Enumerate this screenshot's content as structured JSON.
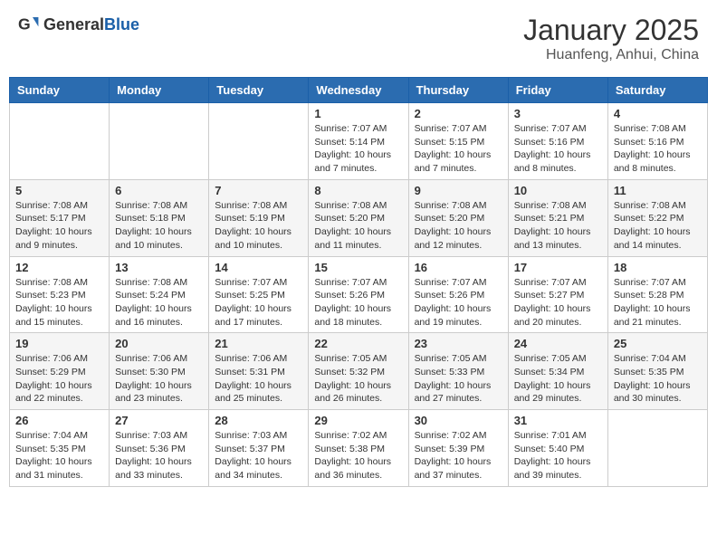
{
  "header": {
    "logo_general": "General",
    "logo_blue": "Blue",
    "month": "January 2025",
    "location": "Huanfeng, Anhui, China"
  },
  "weekdays": [
    "Sunday",
    "Monday",
    "Tuesday",
    "Wednesday",
    "Thursday",
    "Friday",
    "Saturday"
  ],
  "weeks": [
    [
      {
        "day": "",
        "info": ""
      },
      {
        "day": "",
        "info": ""
      },
      {
        "day": "",
        "info": ""
      },
      {
        "day": "1",
        "info": "Sunrise: 7:07 AM\nSunset: 5:14 PM\nDaylight: 10 hours\nand 7 minutes."
      },
      {
        "day": "2",
        "info": "Sunrise: 7:07 AM\nSunset: 5:15 PM\nDaylight: 10 hours\nand 7 minutes."
      },
      {
        "day": "3",
        "info": "Sunrise: 7:07 AM\nSunset: 5:16 PM\nDaylight: 10 hours\nand 8 minutes."
      },
      {
        "day": "4",
        "info": "Sunrise: 7:08 AM\nSunset: 5:16 PM\nDaylight: 10 hours\nand 8 minutes."
      }
    ],
    [
      {
        "day": "5",
        "info": "Sunrise: 7:08 AM\nSunset: 5:17 PM\nDaylight: 10 hours\nand 9 minutes."
      },
      {
        "day": "6",
        "info": "Sunrise: 7:08 AM\nSunset: 5:18 PM\nDaylight: 10 hours\nand 10 minutes."
      },
      {
        "day": "7",
        "info": "Sunrise: 7:08 AM\nSunset: 5:19 PM\nDaylight: 10 hours\nand 10 minutes."
      },
      {
        "day": "8",
        "info": "Sunrise: 7:08 AM\nSunset: 5:20 PM\nDaylight: 10 hours\nand 11 minutes."
      },
      {
        "day": "9",
        "info": "Sunrise: 7:08 AM\nSunset: 5:20 PM\nDaylight: 10 hours\nand 12 minutes."
      },
      {
        "day": "10",
        "info": "Sunrise: 7:08 AM\nSunset: 5:21 PM\nDaylight: 10 hours\nand 13 minutes."
      },
      {
        "day": "11",
        "info": "Sunrise: 7:08 AM\nSunset: 5:22 PM\nDaylight: 10 hours\nand 14 minutes."
      }
    ],
    [
      {
        "day": "12",
        "info": "Sunrise: 7:08 AM\nSunset: 5:23 PM\nDaylight: 10 hours\nand 15 minutes."
      },
      {
        "day": "13",
        "info": "Sunrise: 7:08 AM\nSunset: 5:24 PM\nDaylight: 10 hours\nand 16 minutes."
      },
      {
        "day": "14",
        "info": "Sunrise: 7:07 AM\nSunset: 5:25 PM\nDaylight: 10 hours\nand 17 minutes."
      },
      {
        "day": "15",
        "info": "Sunrise: 7:07 AM\nSunset: 5:26 PM\nDaylight: 10 hours\nand 18 minutes."
      },
      {
        "day": "16",
        "info": "Sunrise: 7:07 AM\nSunset: 5:26 PM\nDaylight: 10 hours\nand 19 minutes."
      },
      {
        "day": "17",
        "info": "Sunrise: 7:07 AM\nSunset: 5:27 PM\nDaylight: 10 hours\nand 20 minutes."
      },
      {
        "day": "18",
        "info": "Sunrise: 7:07 AM\nSunset: 5:28 PM\nDaylight: 10 hours\nand 21 minutes."
      }
    ],
    [
      {
        "day": "19",
        "info": "Sunrise: 7:06 AM\nSunset: 5:29 PM\nDaylight: 10 hours\nand 22 minutes."
      },
      {
        "day": "20",
        "info": "Sunrise: 7:06 AM\nSunset: 5:30 PM\nDaylight: 10 hours\nand 23 minutes."
      },
      {
        "day": "21",
        "info": "Sunrise: 7:06 AM\nSunset: 5:31 PM\nDaylight: 10 hours\nand 25 minutes."
      },
      {
        "day": "22",
        "info": "Sunrise: 7:05 AM\nSunset: 5:32 PM\nDaylight: 10 hours\nand 26 minutes."
      },
      {
        "day": "23",
        "info": "Sunrise: 7:05 AM\nSunset: 5:33 PM\nDaylight: 10 hours\nand 27 minutes."
      },
      {
        "day": "24",
        "info": "Sunrise: 7:05 AM\nSunset: 5:34 PM\nDaylight: 10 hours\nand 29 minutes."
      },
      {
        "day": "25",
        "info": "Sunrise: 7:04 AM\nSunset: 5:35 PM\nDaylight: 10 hours\nand 30 minutes."
      }
    ],
    [
      {
        "day": "26",
        "info": "Sunrise: 7:04 AM\nSunset: 5:35 PM\nDaylight: 10 hours\nand 31 minutes."
      },
      {
        "day": "27",
        "info": "Sunrise: 7:03 AM\nSunset: 5:36 PM\nDaylight: 10 hours\nand 33 minutes."
      },
      {
        "day": "28",
        "info": "Sunrise: 7:03 AM\nSunset: 5:37 PM\nDaylight: 10 hours\nand 34 minutes."
      },
      {
        "day": "29",
        "info": "Sunrise: 7:02 AM\nSunset: 5:38 PM\nDaylight: 10 hours\nand 36 minutes."
      },
      {
        "day": "30",
        "info": "Sunrise: 7:02 AM\nSunset: 5:39 PM\nDaylight: 10 hours\nand 37 minutes."
      },
      {
        "day": "31",
        "info": "Sunrise: 7:01 AM\nSunset: 5:40 PM\nDaylight: 10 hours\nand 39 minutes."
      },
      {
        "day": "",
        "info": ""
      }
    ]
  ]
}
